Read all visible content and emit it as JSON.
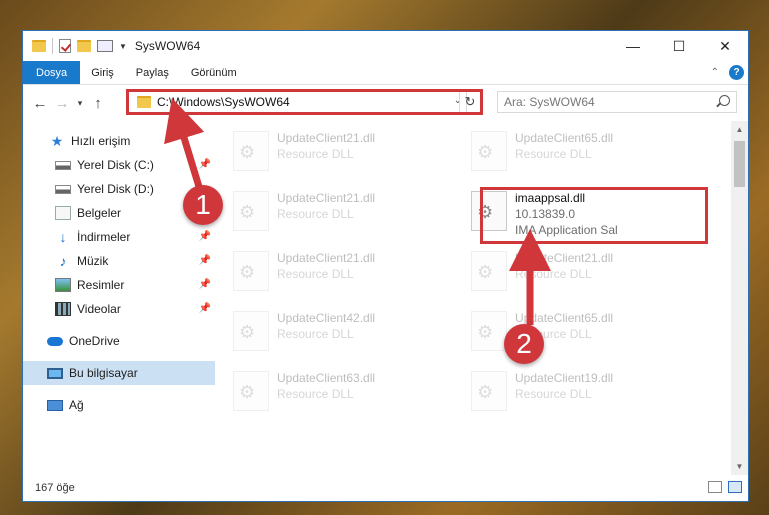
{
  "window": {
    "title": "SysWOW64",
    "minimize_glyph": "—",
    "maximize_glyph": "☐",
    "close_glyph": "✕"
  },
  "ribbon": {
    "tabs": [
      "Dosya",
      "Giriş",
      "Paylaş",
      "Görünüm"
    ],
    "help_glyph": "?",
    "expand_glyph": "⌃"
  },
  "address": {
    "path": "C:\\Windows\\SysWOW64",
    "dropdown_glyph": "⌄",
    "refresh_glyph": "↻"
  },
  "search": {
    "placeholder": "Ara: SysWOW64"
  },
  "nav": {
    "back_glyph": "←",
    "forward_glyph": "→",
    "recent_glyph": "▾",
    "up_glyph": "↑",
    "items": [
      {
        "label": "Hızlı erişim",
        "icon": "star-icon",
        "pinned": false
      },
      {
        "label": "Yerel Disk (C:)",
        "icon": "drive-icon",
        "pinned": true
      },
      {
        "label": "Yerel Disk (D:)",
        "icon": "drive-icon",
        "pinned": false
      },
      {
        "label": "Belgeler",
        "icon": "documents-icon",
        "pinned": false
      },
      {
        "label": "İndirmeler",
        "icon": "downloads-icon",
        "pinned": true
      },
      {
        "label": "Müzik",
        "icon": "music-icon",
        "pinned": true
      },
      {
        "label": "Resimler",
        "icon": "pictures-icon",
        "pinned": true
      },
      {
        "label": "Videolar",
        "icon": "videos-icon",
        "pinned": true
      },
      {
        "label": "OneDrive",
        "icon": "cloud-icon",
        "pinned": false
      },
      {
        "label": "Bu bilgisayar",
        "icon": "pc-icon",
        "pinned": false
      },
      {
        "label": "Ağ",
        "icon": "network-icon",
        "pinned": false
      }
    ]
  },
  "files": [
    {
      "name": "UpdateClient21.dll",
      "type": "Resource DLL"
    },
    {
      "name": "UpdateClient65.dll",
      "type": "Resource DLL"
    },
    {
      "name": "UpdateClient21.dll",
      "type": "Resource DLL"
    },
    {
      "name": "imaappsal.dll",
      "version": "10.13839.0",
      "type": "IMA Application Sal"
    },
    {
      "name": "UpdateClient21.dll",
      "type": "Resource DLL"
    },
    {
      "name": "UpdateClient21.dll",
      "type": "Resource DLL"
    },
    {
      "name": "UpdateClient42.dll",
      "type": "Resource DLL"
    },
    {
      "name": "UpdateClient65.dll",
      "type": "Resource DLL"
    },
    {
      "name": "UpdateClient63.dll",
      "type": "Resource DLL"
    },
    {
      "name": "UpdateClient19.dll",
      "type": "Resource DLL"
    }
  ],
  "status": {
    "count": "167 öğe"
  },
  "markers": {
    "one": "1",
    "two": "2"
  },
  "colors": {
    "accent": "#1979ca",
    "highlight": "#d0373b",
    "selection": "#cce0f4"
  }
}
